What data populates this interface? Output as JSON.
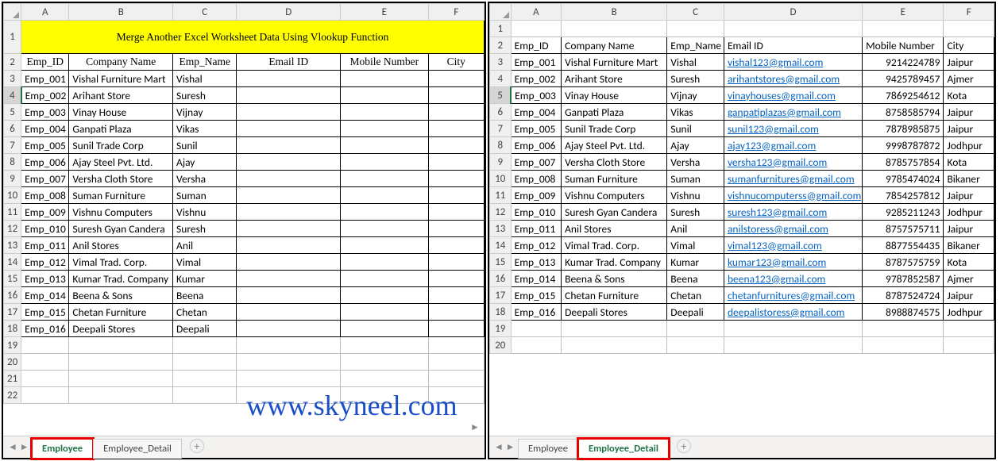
{
  "watermark": "www.skyneel.com",
  "left": {
    "title": "Merge Another Excel Worksheet Data Using Vlookup Function",
    "cols": [
      "A",
      "B",
      "C",
      "D",
      "E",
      "F"
    ],
    "headers": [
      "Emp_ID",
      "Company Name",
      "Emp_Name",
      "Email ID",
      "Mobile Number",
      "City"
    ],
    "rows": [
      {
        "n": 3,
        "id": "Emp_001",
        "company": "Vishal Furniture Mart",
        "emp": "Vishal",
        "email": "",
        "mobile": "",
        "city": ""
      },
      {
        "n": 4,
        "id": "Emp_002",
        "company": "Arihant Store",
        "emp": "Suresh",
        "email": "",
        "mobile": "",
        "city": ""
      },
      {
        "n": 5,
        "id": "Emp_003",
        "company": "Vinay House",
        "emp": "Vijnay",
        "email": "",
        "mobile": "",
        "city": ""
      },
      {
        "n": 6,
        "id": "Emp_004",
        "company": "Ganpati Plaza",
        "emp": "Vikas",
        "email": "",
        "mobile": "",
        "city": ""
      },
      {
        "n": 7,
        "id": "Emp_005",
        "company": "Sunil Trade Corp",
        "emp": "Sunil",
        "email": "",
        "mobile": "",
        "city": ""
      },
      {
        "n": 8,
        "id": "Emp_006",
        "company": "Ajay Steel Pvt. Ltd.",
        "emp": "Ajay",
        "email": "",
        "mobile": "",
        "city": ""
      },
      {
        "n": 9,
        "id": "Emp_007",
        "company": "Versha Cloth Store",
        "emp": "Versha",
        "email": "",
        "mobile": "",
        "city": ""
      },
      {
        "n": 10,
        "id": "Emp_008",
        "company": "Suman Furniture",
        "emp": "Suman",
        "email": "",
        "mobile": "",
        "city": ""
      },
      {
        "n": 11,
        "id": "Emp_009",
        "company": "Vishnu Computers",
        "emp": "Vishnu",
        "email": "",
        "mobile": "",
        "city": ""
      },
      {
        "n": 12,
        "id": "Emp_010",
        "company": "Suresh Gyan Candera",
        "emp": "Suresh",
        "email": "",
        "mobile": "",
        "city": ""
      },
      {
        "n": 13,
        "id": "Emp_011",
        "company": "Anil Stores",
        "emp": "Anil",
        "email": "",
        "mobile": "",
        "city": ""
      },
      {
        "n": 14,
        "id": "Emp_012",
        "company": "Vimal Trad. Corp.",
        "emp": "Vimal",
        "email": "",
        "mobile": "",
        "city": ""
      },
      {
        "n": 15,
        "id": "Emp_013",
        "company": "Kumar Trad. Company",
        "emp": "Kumar",
        "email": "",
        "mobile": "",
        "city": ""
      },
      {
        "n": 16,
        "id": "Emp_014",
        "company": "Beena & Sons",
        "emp": "Beena",
        "email": "",
        "mobile": "",
        "city": ""
      },
      {
        "n": 17,
        "id": "Emp_015",
        "company": "Chetan Furniture",
        "emp": "Chetan",
        "email": "",
        "mobile": "",
        "city": ""
      },
      {
        "n": 18,
        "id": "Emp_016",
        "company": "Deepali Stores",
        "emp": "Deepali",
        "email": "",
        "mobile": "",
        "city": ""
      }
    ],
    "extra_rows": [
      19,
      20,
      21,
      22
    ],
    "tabs": [
      {
        "label": "Employee",
        "active": true,
        "hl": true
      },
      {
        "label": "Employee_Detail",
        "active": false,
        "hl": false
      }
    ],
    "newtab": "+",
    "selected_row": 4
  },
  "right": {
    "cols": [
      "A",
      "B",
      "C",
      "D",
      "E",
      "F"
    ],
    "headers": [
      "Emp_ID",
      "Company Name",
      "Emp_Name",
      "Email ID",
      "Mobile Number",
      "City"
    ],
    "rows": [
      {
        "n": 3,
        "id": "Emp_001",
        "company": "Vishal Furniture Mart",
        "emp": "Vishal",
        "email": "vishal123@gmail.com",
        "mobile": "9214224789",
        "city": "Jaipur"
      },
      {
        "n": 4,
        "id": "Emp_002",
        "company": "Arihant Store",
        "emp": "Suresh",
        "email": "arihantstores@gmail.com",
        "mobile": "9425789457",
        "city": "Ajmer"
      },
      {
        "n": 5,
        "id": "Emp_003",
        "company": "Vinay House",
        "emp": "Vijnay",
        "email": "vinayhouses@gmail.com",
        "mobile": "7869254612",
        "city": "Kota"
      },
      {
        "n": 6,
        "id": "Emp_004",
        "company": "Ganpati Plaza",
        "emp": "Vikas",
        "email": "ganpatiplazas@gmail.com",
        "mobile": "8758585794",
        "city": "Jaipur"
      },
      {
        "n": 7,
        "id": "Emp_005",
        "company": "Sunil Trade Corp",
        "emp": "Sunil",
        "email": "sunil123@gmail.com",
        "mobile": "7878985875",
        "city": "Jaipur"
      },
      {
        "n": 8,
        "id": "Emp_006",
        "company": "Ajay Steel Pvt. Ltd.",
        "emp": "Ajay",
        "email": "ajay123@gmail.com",
        "mobile": "9998787872",
        "city": "Jodhpur"
      },
      {
        "n": 9,
        "id": "Emp_007",
        "company": "Versha Cloth Store",
        "emp": "Versha",
        "email": "versha123@gmail.com",
        "mobile": "8785757854",
        "city": "Kota"
      },
      {
        "n": 10,
        "id": "Emp_008",
        "company": "Suman Furniture",
        "emp": "Suman",
        "email": "sumanfurnitures@gmail.com",
        "mobile": "9785474024",
        "city": "Bikaner"
      },
      {
        "n": 11,
        "id": "Emp_009",
        "company": "Vishnu Computers",
        "emp": "Vishnu",
        "email": "vishnucomputerss@gmail.com",
        "mobile": "7854257812",
        "city": "Jaipur"
      },
      {
        "n": 12,
        "id": "Emp_010",
        "company": "Suresh Gyan Candera",
        "emp": "Suresh",
        "email": "suresh123@gmail.com",
        "mobile": "9285211243",
        "city": "Jodhpur"
      },
      {
        "n": 13,
        "id": "Emp_011",
        "company": "Anil Stores",
        "emp": "Anil",
        "email": "anilstoress@gmail.com",
        "mobile": "8757575711",
        "city": "Jaipur"
      },
      {
        "n": 14,
        "id": "Emp_012",
        "company": "Vimal Trad. Corp.",
        "emp": "Vimal",
        "email": "vimal123@gmail.com",
        "mobile": "8877554435",
        "city": "Bikaner"
      },
      {
        "n": 15,
        "id": "Emp_013",
        "company": "Kumar Trad. Company",
        "emp": "Kumar",
        "email": "kumar123@gmail.com",
        "mobile": "8787575759",
        "city": "Kota"
      },
      {
        "n": 16,
        "id": "Emp_014",
        "company": "Beena & Sons",
        "emp": "Beena",
        "email": "beena123@gmail.com",
        "mobile": "9787852587",
        "city": "Ajmer"
      },
      {
        "n": 17,
        "id": "Emp_015",
        "company": "Chetan Furniture",
        "emp": "Chetan",
        "email": "chetanfurnitures@gmail.com",
        "mobile": "8787524724",
        "city": "Jaipur"
      },
      {
        "n": 18,
        "id": "Emp_016",
        "company": "Deepali Stores",
        "emp": "Deepali",
        "email": "deepalistoress@gmail.com",
        "mobile": "8988874575",
        "city": "Jodhpur"
      }
    ],
    "extra_rows": [
      19,
      20
    ],
    "tabs": [
      {
        "label": "Employee",
        "active": false,
        "hl": false
      },
      {
        "label": "Employee_Detail",
        "active": true,
        "hl": true
      }
    ],
    "newtab": "+",
    "selected_row": 5
  }
}
